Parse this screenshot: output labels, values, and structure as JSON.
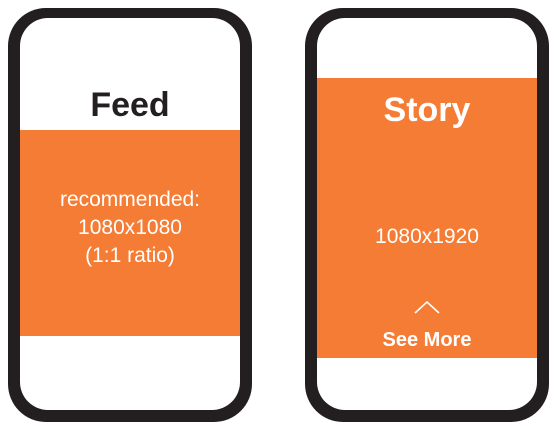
{
  "feed": {
    "title": "Feed",
    "lines": [
      "recommended:",
      "1080x1080",
      "(1:1 ratio)"
    ]
  },
  "story": {
    "title": "Story",
    "size": "1080x1920",
    "see_more": "See More"
  },
  "colors": {
    "phone_body": "#231f20",
    "accent_orange": "#f47c34",
    "bezel": "#ffffff"
  },
  "icons": {
    "story_swipe": "chevron-up-icon"
  }
}
